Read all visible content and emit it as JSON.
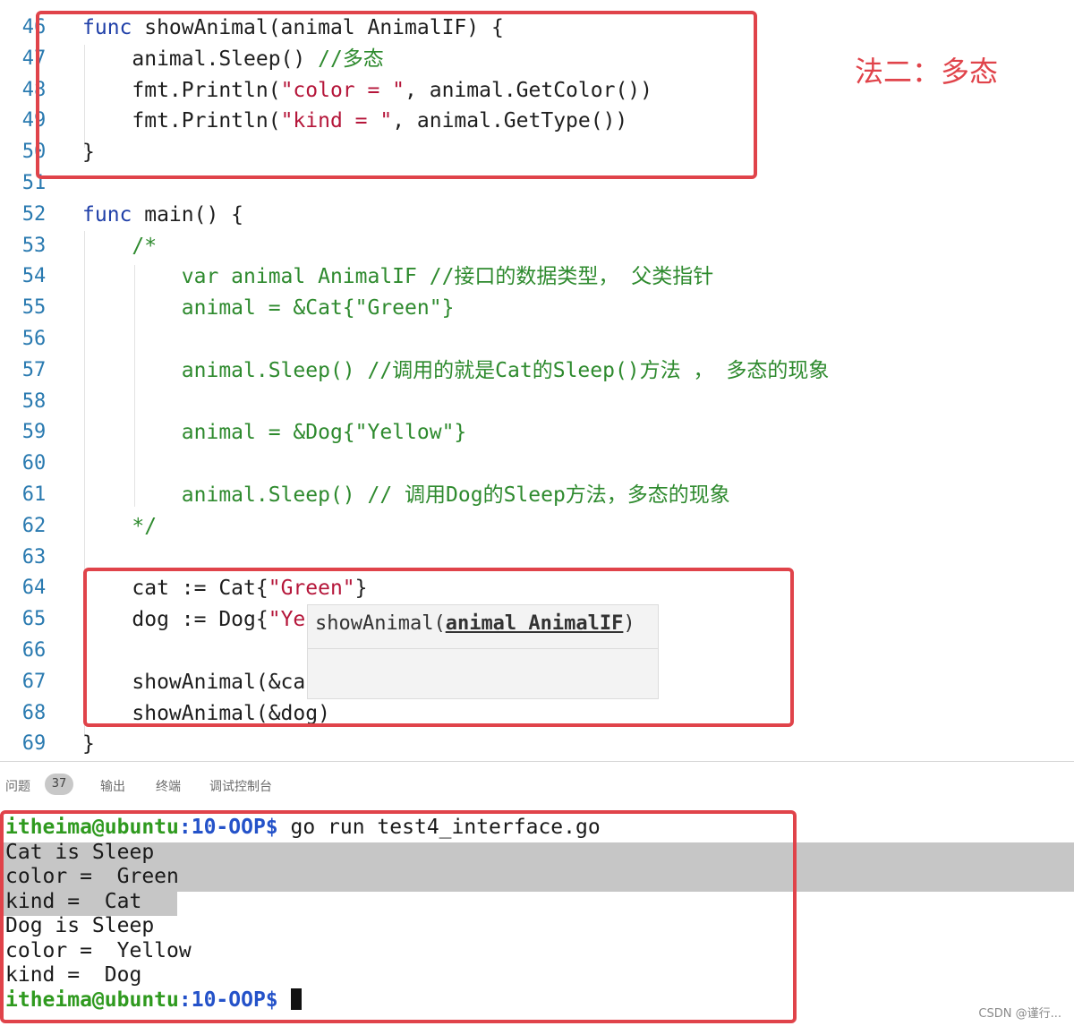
{
  "annotation": "法二：多态",
  "editor": {
    "lines": [
      {
        "num": "46",
        "segments": [
          {
            "t": "func",
            "c": "kw"
          },
          {
            "t": " showAnimal(animal AnimalIF) {",
            "c": ""
          }
        ]
      },
      {
        "num": "47",
        "segments": [
          {
            "t": "    animal.Sleep() ",
            "c": ""
          },
          {
            "t": "//多态",
            "c": "cmt"
          }
        ]
      },
      {
        "num": "48",
        "segments": [
          {
            "t": "    fmt.Println(",
            "c": ""
          },
          {
            "t": "\"color = \"",
            "c": "str"
          },
          {
            "t": ", animal.GetColor())",
            "c": ""
          }
        ]
      },
      {
        "num": "49",
        "segments": [
          {
            "t": "    fmt.Println(",
            "c": ""
          },
          {
            "t": "\"kind = \"",
            "c": "str"
          },
          {
            "t": ", animal.GetType())",
            "c": ""
          }
        ]
      },
      {
        "num": "50",
        "segments": [
          {
            "t": "}",
            "c": ""
          }
        ]
      },
      {
        "num": "51",
        "segments": []
      },
      {
        "num": "52",
        "segments": [
          {
            "t": "func",
            "c": "kw"
          },
          {
            "t": " main() {",
            "c": ""
          }
        ]
      },
      {
        "num": "53",
        "segments": [
          {
            "t": "    /*",
            "c": "cmt"
          }
        ]
      },
      {
        "num": "54",
        "segments": [
          {
            "t": "        var animal AnimalIF //接口的数据类型， 父类指针",
            "c": "cmt"
          }
        ]
      },
      {
        "num": "55",
        "segments": [
          {
            "t": "        animal = &Cat{\"Green\"}",
            "c": "cmt"
          }
        ]
      },
      {
        "num": "56",
        "segments": []
      },
      {
        "num": "57",
        "segments": [
          {
            "t": "        animal.Sleep() //调用的就是Cat的Sleep()方法 ， 多态的现象",
            "c": "cmt"
          }
        ]
      },
      {
        "num": "58",
        "segments": []
      },
      {
        "num": "59",
        "segments": [
          {
            "t": "        animal = &Dog{\"Yellow\"}",
            "c": "cmt"
          }
        ]
      },
      {
        "num": "60",
        "segments": []
      },
      {
        "num": "61",
        "segments": [
          {
            "t": "        animal.Sleep() // 调用Dog的Sleep方法，多态的现象",
            "c": "cmt"
          }
        ]
      },
      {
        "num": "62",
        "segments": [
          {
            "t": "    */",
            "c": "cmt"
          }
        ]
      },
      {
        "num": "63",
        "segments": []
      },
      {
        "num": "64",
        "segments": [
          {
            "t": "    cat := Cat{",
            "c": ""
          },
          {
            "t": "\"Green\"",
            "c": "str"
          },
          {
            "t": "}",
            "c": ""
          }
        ]
      },
      {
        "num": "65",
        "segments": [
          {
            "t": "    dog := Dog{",
            "c": ""
          },
          {
            "t": "\"Ye",
            "c": "str"
          }
        ]
      },
      {
        "num": "66",
        "segments": []
      },
      {
        "num": "67",
        "segments": [
          {
            "t": "    showAnimal(&ca",
            "c": ""
          }
        ]
      },
      {
        "num": "68",
        "segments": [
          {
            "t": "    showAnimal(&dog)",
            "c": ""
          }
        ]
      },
      {
        "num": "69",
        "segments": [
          {
            "t": "}",
            "c": ""
          }
        ]
      }
    ],
    "tooltip": {
      "fn": "showAnimal(",
      "param": "animal AnimalIF",
      "close": ")"
    }
  },
  "panel": {
    "tabs": [
      {
        "label": "问题",
        "badge": "37"
      },
      {
        "label": "输出"
      },
      {
        "label": "终端"
      },
      {
        "label": "调试控制台"
      }
    ]
  },
  "terminal": {
    "prompt_user": "itheima@ubuntu",
    "prompt_path": ":10-OOP$",
    "command": " go run test4_interface.go",
    "output": [
      "Cat is Sleep",
      "color =  Green",
      "kind =  Cat",
      "Dog is Sleep",
      "color =  Yellow",
      "kind =  Dog"
    ],
    "final_prompt_user": "itheima@ubuntu",
    "final_prompt_path": ":10-OOP$ "
  },
  "watermark": "CSDN @谨行..."
}
